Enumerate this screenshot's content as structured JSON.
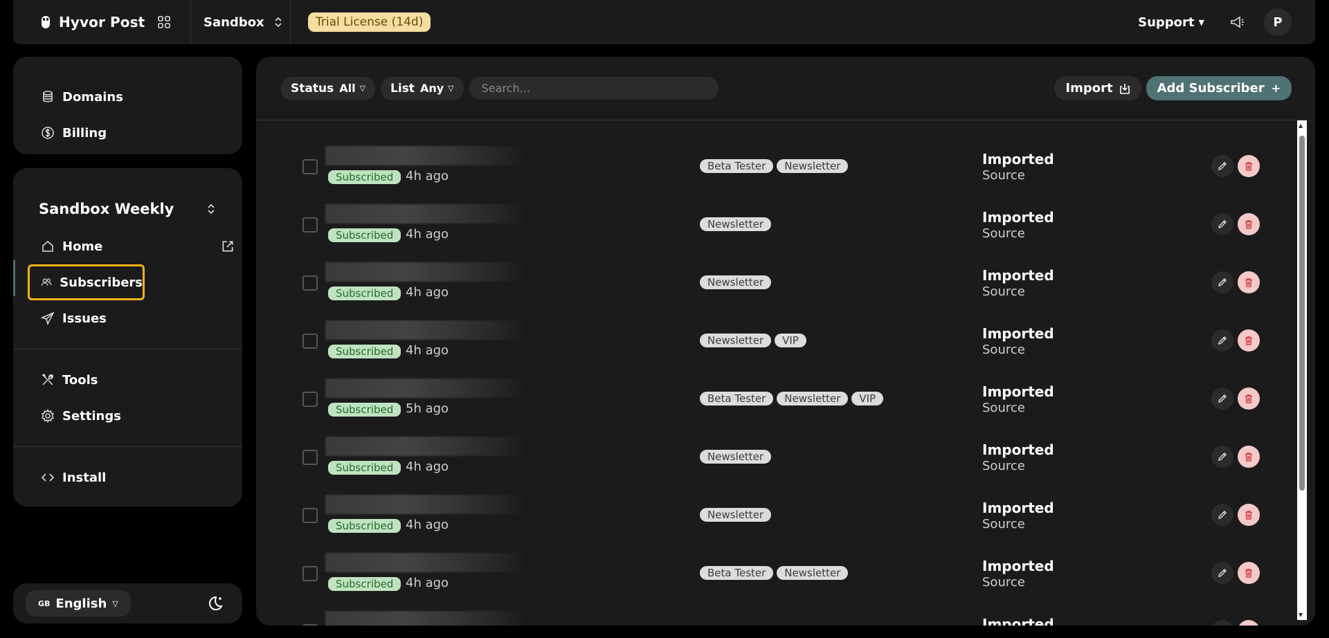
{
  "header": {
    "brand": "Hyvor Post",
    "project": "Sandbox",
    "trial": "Trial License (14d)",
    "support": "Support",
    "avatar_initial": "P"
  },
  "sidebar": {
    "top_items": [
      {
        "label": "Domains",
        "icon": "database-icon"
      },
      {
        "label": "Billing",
        "icon": "dollar-icon"
      }
    ],
    "project_title": "Sandbox Weekly",
    "items": [
      {
        "label": "Home",
        "icon": "home-icon"
      },
      {
        "label": "Subscribers",
        "icon": "users-icon"
      },
      {
        "label": "Issues",
        "icon": "send-icon"
      },
      {
        "label": "Tools",
        "icon": "tools-icon"
      },
      {
        "label": "Settings",
        "icon": "gear-icon"
      },
      {
        "label": "Install",
        "icon": "code-icon"
      }
    ],
    "language": "English",
    "language_flag": "GB"
  },
  "toolbar": {
    "status_label": "Status",
    "status_value": "All",
    "list_label": "List",
    "list_value": "Any",
    "search_placeholder": "Search...",
    "import_label": "Import",
    "add_label": "Add Subscriber"
  },
  "subscribers": [
    {
      "status": "Subscribed",
      "time": "4h ago",
      "tags": [
        "Beta Tester",
        "Newsletter"
      ],
      "source": "Imported",
      "source_label": "Source"
    },
    {
      "status": "Subscribed",
      "time": "4h ago",
      "tags": [
        "Newsletter"
      ],
      "source": "Imported",
      "source_label": "Source"
    },
    {
      "status": "Subscribed",
      "time": "4h ago",
      "tags": [
        "Newsletter"
      ],
      "source": "Imported",
      "source_label": "Source"
    },
    {
      "status": "Subscribed",
      "time": "4h ago",
      "tags": [
        "Newsletter",
        "VIP"
      ],
      "source": "Imported",
      "source_label": "Source"
    },
    {
      "status": "Subscribed",
      "time": "5h ago",
      "tags": [
        "Beta Tester",
        "Newsletter",
        "VIP"
      ],
      "source": "Imported",
      "source_label": "Source"
    },
    {
      "status": "Subscribed",
      "time": "4h ago",
      "tags": [
        "Newsletter"
      ],
      "source": "Imported",
      "source_label": "Source"
    },
    {
      "status": "Subscribed",
      "time": "4h ago",
      "tags": [
        "Newsletter"
      ],
      "source": "Imported",
      "source_label": "Source"
    },
    {
      "status": "Subscribed",
      "time": "4h ago",
      "tags": [
        "Beta Tester",
        "Newsletter"
      ],
      "source": "Imported",
      "source_label": "Source"
    },
    {
      "status": "",
      "time": "",
      "tags": [],
      "source": "Imported",
      "source_label": ""
    }
  ],
  "colors": {
    "background": "#000000",
    "panel": "#1b1b1b",
    "accent": "#4f7275",
    "trial_bg": "#f4dea1",
    "subscribed_bg": "#bfe3c0",
    "highlight": "#f2b215"
  }
}
